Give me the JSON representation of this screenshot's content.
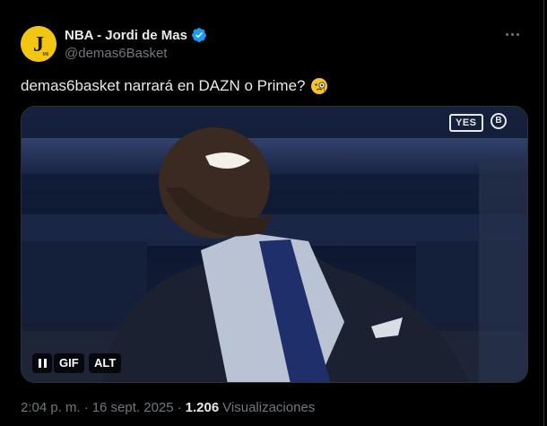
{
  "author": {
    "display_name": "NBA - Jordi de Mas",
    "handle": "@demas6Basket",
    "verified": true,
    "avatar_letter": "J"
  },
  "tweet": {
    "text": "demas6basket narrará en DAZN o Prime?",
    "emoji_name": "face-with-monocle"
  },
  "media": {
    "broadcast_badge": "YES",
    "team_logo_letter": "B",
    "gif_label": "GIF",
    "alt_label": "ALT"
  },
  "footer": {
    "time": "2:04 p. m.",
    "separator1": "·",
    "date": "16 sept. 2025",
    "separator2": "·",
    "views_count": "1.206",
    "views_label": "Visualizaciones"
  },
  "colors": {
    "background": "#000000",
    "text_primary": "#e7e9ea",
    "text_secondary": "#71767b",
    "verified_blue": "#1d9bf0",
    "border": "#2f3336"
  }
}
